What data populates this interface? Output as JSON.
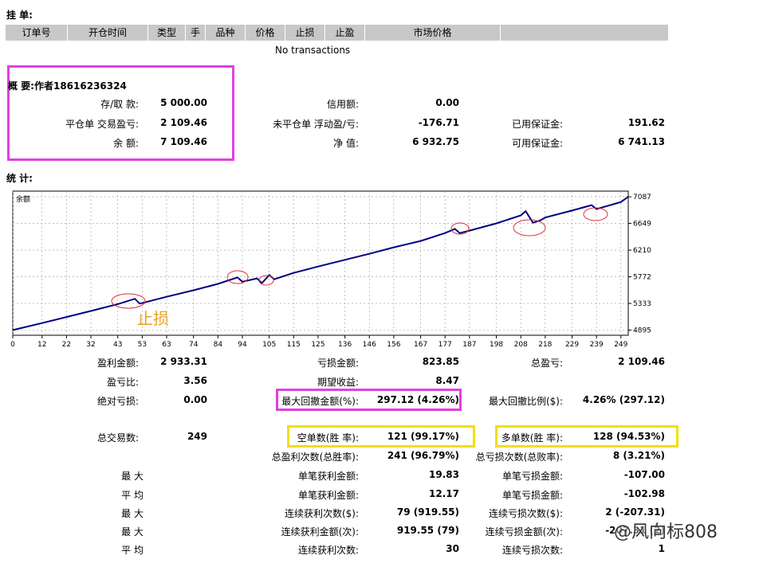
{
  "orders": {
    "title": "挂 单:",
    "columns": [
      "订单号",
      "开仓时间",
      "类型",
      "手",
      "品种",
      "价格",
      "止损",
      "止盈",
      "市场价格",
      ""
    ],
    "empty_text": "No transactions"
  },
  "summary": {
    "title": "概 要:作者18616236324",
    "rows": [
      {
        "l1": "存/取 款:",
        "v1": "5 000.00",
        "l2": "信用额:",
        "v2": "0.00",
        "l3": "",
        "v3": ""
      },
      {
        "l1": "平仓单 交易盈亏:",
        "v1": "2 109.46",
        "l2": "未平仓单 浮动盈/亏:",
        "v2": "-176.71",
        "l3": "已用保证金:",
        "v3": "191.62"
      },
      {
        "l1": "余 额:",
        "v1": "7 109.46",
        "l2": "净 值:",
        "v2": "6 932.75",
        "l3": "可用保证金:",
        "v3": "6 741.13"
      }
    ]
  },
  "stats_title": "统 计:",
  "chart_data": {
    "type": "line",
    "title": "余额",
    "x_ticks": [
      0,
      12,
      22,
      32,
      43,
      53,
      63,
      74,
      84,
      94,
      105,
      115,
      125,
      136,
      146,
      156,
      167,
      177,
      187,
      198,
      208,
      218,
      229,
      239,
      249
    ],
    "y_ticks": [
      4895,
      5333,
      5772,
      6210,
      6649,
      7087
    ],
    "xlim": [
      0,
      252
    ],
    "ylim": [
      4810,
      7180
    ],
    "grid": true,
    "series": [
      {
        "x": [
          0,
          12,
          22,
          32,
          43,
          50,
          52,
          63,
          74,
          84,
          92,
          94,
          100,
          102,
          105,
          107,
          115,
          125,
          136,
          146,
          156,
          167,
          177,
          181,
          183,
          187,
          198,
          208,
          210,
          213,
          216,
          218,
          229,
          237,
          239,
          249,
          252
        ],
        "y": [
          4895,
          5010,
          5110,
          5210,
          5322,
          5410,
          5330,
          5442,
          5550,
          5655,
          5760,
          5690,
          5745,
          5668,
          5800,
          5730,
          5835,
          5940,
          6050,
          6150,
          6255,
          6360,
          6490,
          6560,
          6490,
          6530,
          6650,
          6780,
          6850,
          6660,
          6700,
          6745,
          6860,
          6950,
          6885,
          7000,
          7087
        ]
      }
    ],
    "annotation_text": "止损",
    "annotation_color": "#e8a020",
    "line_color": "#000080"
  },
  "stats": {
    "row1": {
      "l1": "盈利金额:",
      "v1": "2 933.31",
      "l2": "亏损金额:",
      "v2": "823.85",
      "l3": "总盈亏:",
      "v3": "2 109.46"
    },
    "row2": {
      "l1": "盈亏比:",
      "v1": "3.56",
      "l2": "期望收益:",
      "v2": "8.47",
      "l3": "",
      "v3": ""
    },
    "row3": {
      "l1": "绝对亏损:",
      "v1": "0.00",
      "l2": "最大回撤金额(%):",
      "v2": "297.12 (4.26%)",
      "l3": "最大回撤比例($):",
      "v3": "4.26% (297.12)"
    },
    "row4": {
      "l1": "总交易数:",
      "v1": "249",
      "l2": "空单数(胜 率):",
      "v2": "121 (99.17%)",
      "l3": "多单数(胜 率):",
      "v3": "128 (94.53%)"
    },
    "row5": {
      "l2": "总盈利次数(总胜率):",
      "v2": "241 (96.79%)",
      "l3": "总亏损次数(总败率):",
      "v3": "8 (3.21%)"
    },
    "row6": {
      "l1": "最 大",
      "l2": "单笔获利金额:",
      "v2": "19.83",
      "l3": "单笔亏损金额:",
      "v3": "-107.00"
    },
    "row7": {
      "l1": "平 均",
      "l2": "单笔获利金额:",
      "v2": "12.17",
      "l3": "单笔亏损金额:",
      "v3": "-102.98"
    },
    "row8": {
      "l1": "最 大",
      "l2": "连续获利次数($):",
      "v2": "79 (919.55)",
      "l3": "连续亏损次数($):",
      "v3": "2 (-207.31)"
    },
    "row9": {
      "l1": "最 大",
      "l2": "连续获利金额(次):",
      "v2": "919.55 (79)",
      "l3": "连续亏损金额(次):",
      "v3": "-207.31 (2)"
    },
    "row10": {
      "l1": "平 均",
      "l2": "连续获利次数:",
      "v2": "30",
      "l3": "连续亏损次数:",
      "v3": "1"
    }
  },
  "watermark": "@风向标808"
}
